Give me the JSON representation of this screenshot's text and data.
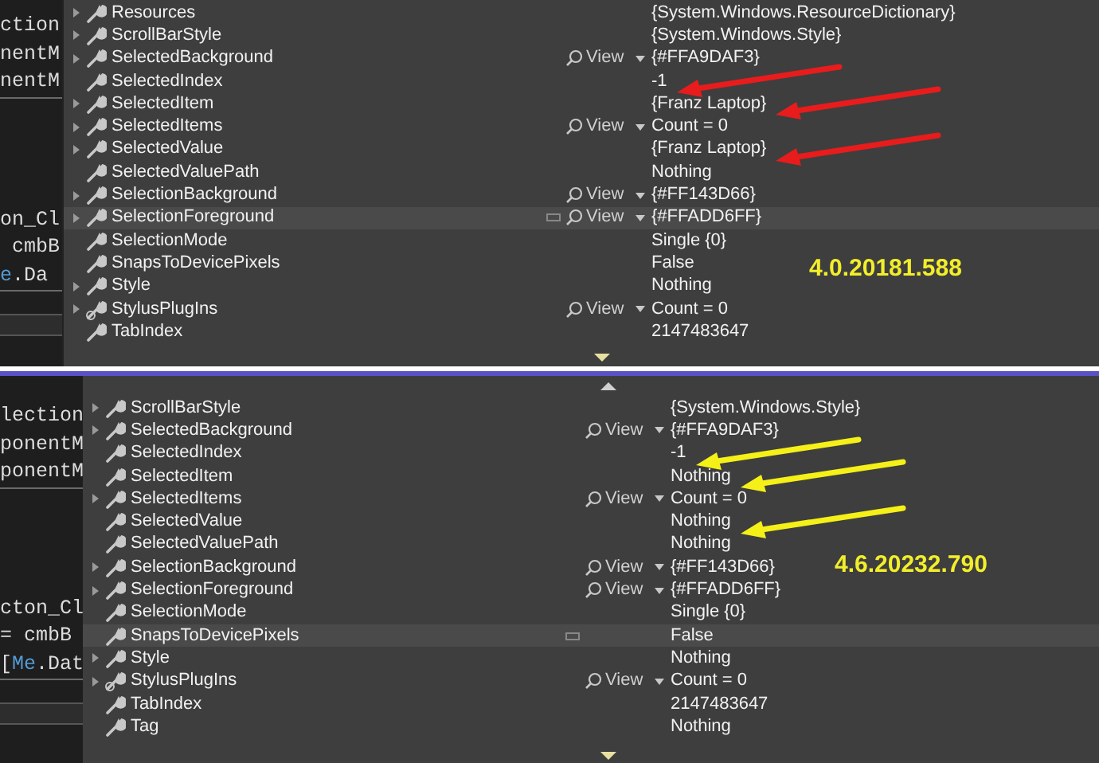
{
  "panels": [
    {
      "version_label": "4.0.20181.588",
      "color": "#e81c1c",
      "code_groups": [
        [
          [
            {
              "text": "ction",
              "kind": "plain"
            }
          ],
          [
            {
              "text": "nentM",
              "kind": "plain"
            }
          ],
          [
            {
              "text": "nentM",
              "kind": "plain"
            }
          ]
        ],
        [
          [
            {
              "text": "on_Cl",
              "kind": "plain"
            }
          ],
          [
            {
              "text": " cmbB",
              "kind": "plain"
            }
          ],
          [
            {
              "text": "e",
              "kind": "keyword"
            },
            {
              "text": ".Da",
              "kind": "plain"
            }
          ]
        ]
      ],
      "rows": [
        {
          "name": "Resources",
          "expandable": true,
          "kind": "wrench",
          "view": "",
          "value": "{System.Windows.ResourceDictionary}",
          "selected": false,
          "arrow": false
        },
        {
          "name": "ScrollBarStyle",
          "expandable": true,
          "kind": "wrench",
          "view": "",
          "value": "{System.Windows.Style}",
          "selected": false,
          "arrow": false
        },
        {
          "name": "SelectedBackground",
          "expandable": true,
          "kind": "wrench",
          "view": "View",
          "value": "{#FFA9DAF3}",
          "selected": false,
          "arrow": false
        },
        {
          "name": "SelectedIndex",
          "expandable": false,
          "kind": "wrench",
          "view": "",
          "value": "-1",
          "selected": false,
          "arrow": true
        },
        {
          "name": "SelectedItem",
          "expandable": true,
          "kind": "wrench",
          "view": "",
          "value": "{Franz Laptop}",
          "selected": false,
          "arrow": true
        },
        {
          "name": "SelectedItems",
          "expandable": true,
          "kind": "wrench",
          "view": "View",
          "value": "Count = 0",
          "selected": false,
          "arrow": false
        },
        {
          "name": "SelectedValue",
          "expandable": true,
          "kind": "wrench",
          "view": "",
          "value": "{Franz Laptop}",
          "selected": false,
          "arrow": true
        },
        {
          "name": "SelectedValuePath",
          "expandable": false,
          "kind": "wrench",
          "view": "",
          "value": "Nothing",
          "selected": false,
          "arrow": false
        },
        {
          "name": "SelectionBackground",
          "expandable": true,
          "kind": "wrench",
          "view": "View",
          "value": "{#FF143D66}",
          "selected": false,
          "arrow": false
        },
        {
          "name": "SelectionForeground",
          "expandable": true,
          "kind": "wrench",
          "view": "View",
          "value": "{#FFADD6FF}",
          "selected": true,
          "arrow": false
        },
        {
          "name": "SelectionMode",
          "expandable": false,
          "kind": "wrench",
          "view": "",
          "value": "Single {0}",
          "selected": false,
          "arrow": false
        },
        {
          "name": "SnapsToDevicePixels",
          "expandable": false,
          "kind": "wrench",
          "view": "",
          "value": "False",
          "selected": false,
          "arrow": false
        },
        {
          "name": "Style",
          "expandable": true,
          "kind": "wrench",
          "view": "",
          "value": "Nothing",
          "selected": false,
          "arrow": false
        },
        {
          "name": "StylusPlugIns",
          "expandable": true,
          "kind": "plugin",
          "view": "View",
          "value": "Count = 0",
          "selected": false,
          "arrow": false
        },
        {
          "name": "TabIndex",
          "expandable": false,
          "kind": "wrench",
          "view": "",
          "value": "2147483647",
          "selected": false,
          "arrow": false
        }
      ]
    },
    {
      "version_label": "4.6.20232.790",
      "color": "#f5f017",
      "code_groups": [
        [
          [
            {
              "text": "lection",
              "kind": "plain"
            }
          ],
          [
            {
              "text": "ponentM",
              "kind": "plain"
            }
          ],
          [
            {
              "text": "ponentM",
              "kind": "plain"
            }
          ]
        ],
        [
          [
            {
              "text": "cton_Cl",
              "kind": "plain"
            }
          ],
          [
            {
              "text": "= cmbB",
              "kind": "plain"
            }
          ],
          [
            {
              "text": "[",
              "kind": "plain"
            },
            {
              "text": "Me",
              "kind": "keyword"
            },
            {
              "text": ".Dat",
              "kind": "plain"
            }
          ]
        ]
      ],
      "rows": [
        {
          "name": "ScrollBarStyle",
          "expandable": true,
          "kind": "wrench",
          "view": "",
          "value": "{System.Windows.Style}",
          "selected": false,
          "arrow": false
        },
        {
          "name": "SelectedBackground",
          "expandable": true,
          "kind": "wrench",
          "view": "View",
          "value": "{#FFA9DAF3}",
          "selected": false,
          "arrow": false
        },
        {
          "name": "SelectedIndex",
          "expandable": false,
          "kind": "wrench",
          "view": "",
          "value": "-1",
          "selected": false,
          "arrow": true
        },
        {
          "name": "SelectedItem",
          "expandable": false,
          "kind": "wrench",
          "view": "",
          "value": "Nothing",
          "selected": false,
          "arrow": true
        },
        {
          "name": "SelectedItems",
          "expandable": true,
          "kind": "wrench",
          "view": "View",
          "value": "Count = 0",
          "selected": false,
          "arrow": false
        },
        {
          "name": "SelectedValue",
          "expandable": false,
          "kind": "wrench",
          "view": "",
          "value": "Nothing",
          "selected": false,
          "arrow": true
        },
        {
          "name": "SelectedValuePath",
          "expandable": false,
          "kind": "wrench",
          "view": "",
          "value": "Nothing",
          "selected": false,
          "arrow": false
        },
        {
          "name": "SelectionBackground",
          "expandable": true,
          "kind": "wrench",
          "view": "View",
          "value": "{#FF143D66}",
          "selected": false,
          "arrow": false
        },
        {
          "name": "SelectionForeground",
          "expandable": true,
          "kind": "wrench",
          "view": "View",
          "value": "{#FFADD6FF}",
          "selected": false,
          "arrow": false
        },
        {
          "name": "SelectionMode",
          "expandable": false,
          "kind": "wrench",
          "view": "",
          "value": "Single {0}",
          "selected": false,
          "arrow": false
        },
        {
          "name": "SnapsToDevicePixels",
          "expandable": false,
          "kind": "wrench",
          "view": "",
          "value": "False",
          "selected": true,
          "arrow": false
        },
        {
          "name": "Style",
          "expandable": true,
          "kind": "wrench",
          "view": "",
          "value": "Nothing",
          "selected": false,
          "arrow": false
        },
        {
          "name": "StylusPlugIns",
          "expandable": true,
          "kind": "plugin",
          "view": "View",
          "value": "Count = 0",
          "selected": false,
          "arrow": false
        },
        {
          "name": "TabIndex",
          "expandable": false,
          "kind": "wrench",
          "view": "",
          "value": "2147483647",
          "selected": false,
          "arrow": false
        },
        {
          "name": "Tag",
          "expandable": false,
          "kind": "wrench",
          "view": "",
          "value": "Nothing",
          "selected": false,
          "arrow": false
        }
      ]
    }
  ]
}
